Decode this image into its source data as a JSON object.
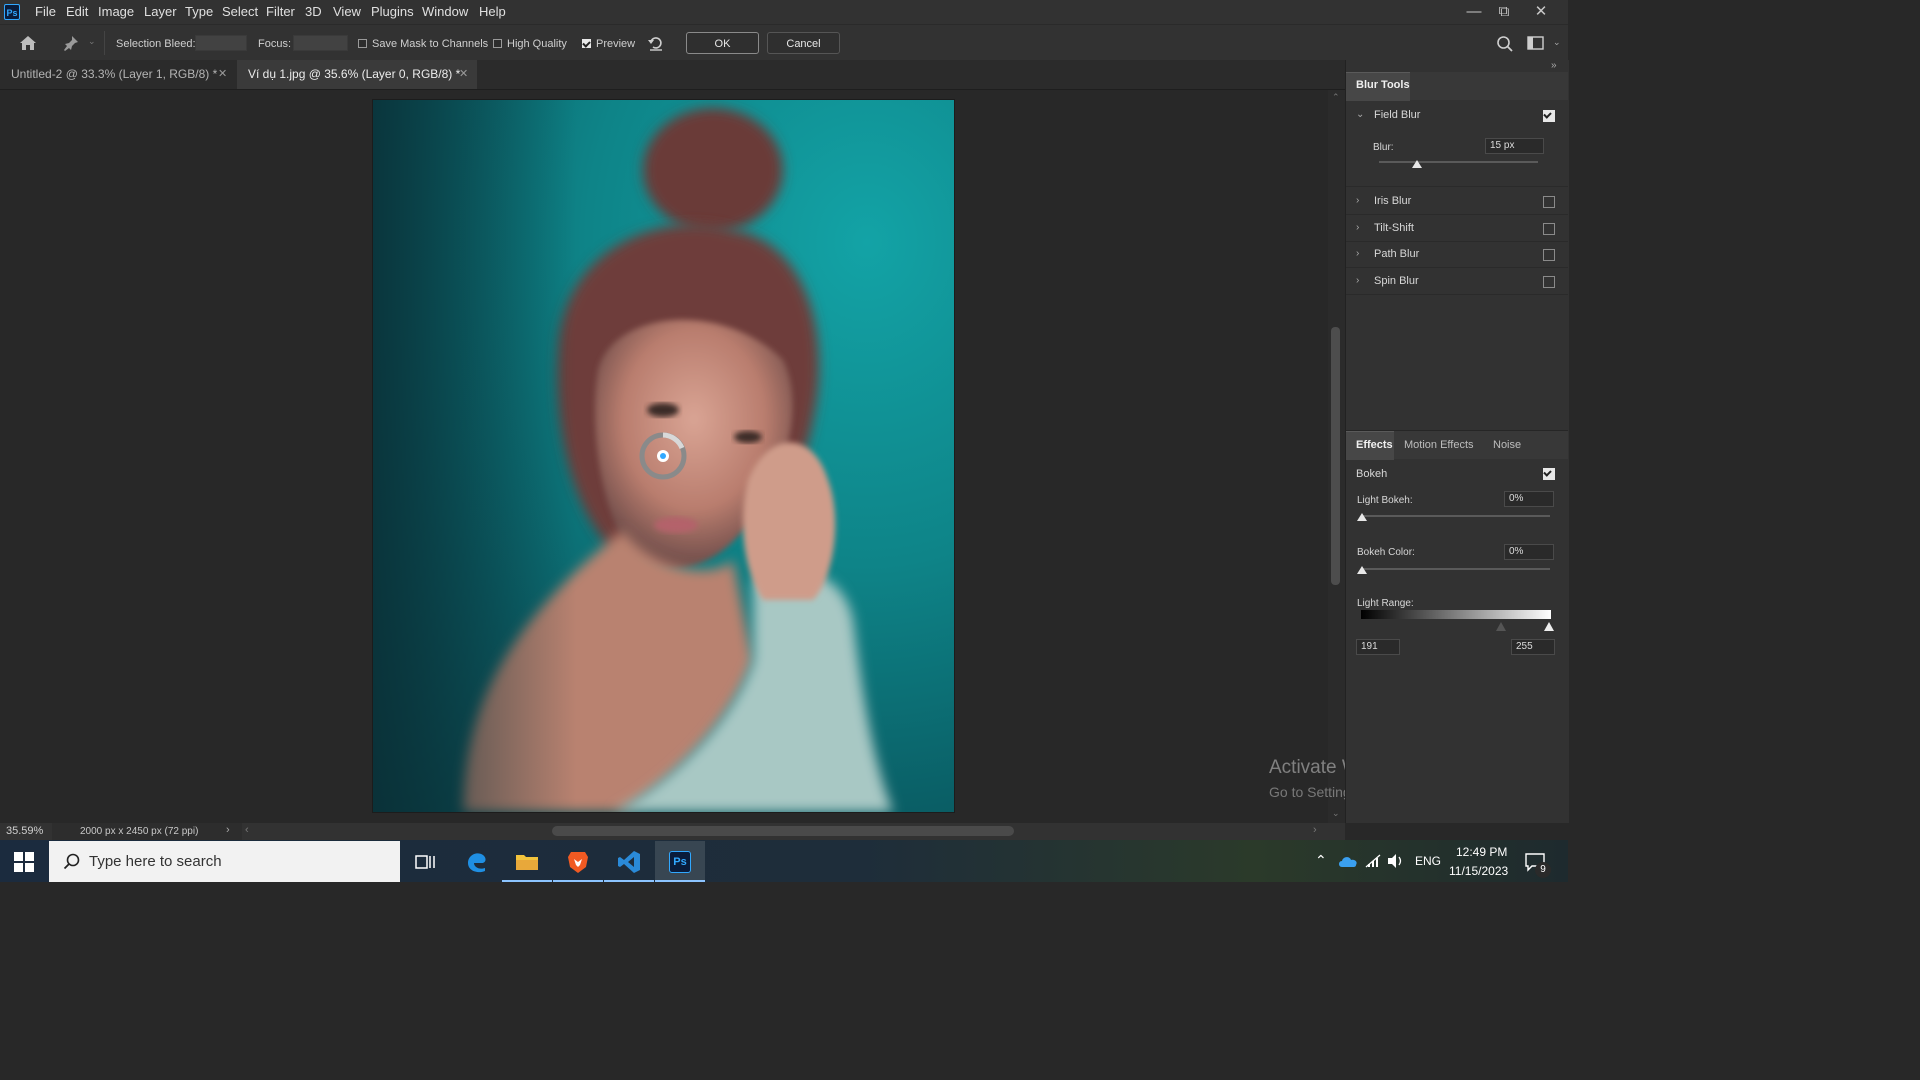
{
  "app": {
    "logo_text": "Ps"
  },
  "menu": [
    "File",
    "Edit",
    "Image",
    "Layer",
    "Type",
    "Select",
    "Filter",
    "3D",
    "View",
    "Plugins",
    "Window",
    "Help"
  ],
  "options_bar": {
    "selection_bleed_label": "Selection Bleed:",
    "focus_label": "Focus:",
    "save_mask_label": "Save Mask to Channels",
    "save_mask_checked": false,
    "high_quality_label": "High Quality",
    "high_quality_checked": false,
    "preview_label": "Preview",
    "preview_checked": true,
    "ok_label": "OK",
    "cancel_label": "Cancel"
  },
  "tabs": [
    {
      "label": "Untitled-2 @ 33.3% (Layer 1, RGB/8) *",
      "active": false
    },
    {
      "label": "Ví dụ 1.jpg @ 35.6% (Layer 0, RGB/8) *",
      "active": true
    }
  ],
  "blur_tools": {
    "title": "Blur Tools",
    "field_blur": {
      "label": "Field Blur",
      "checked": true,
      "blur_label": "Blur:",
      "blur_value": "15 px",
      "blur_slider_fraction": 0.24
    },
    "items": [
      {
        "label": "Iris Blur",
        "checked": false
      },
      {
        "label": "Tilt-Shift",
        "checked": false
      },
      {
        "label": "Path Blur",
        "checked": false
      },
      {
        "label": "Spin Blur",
        "checked": false
      }
    ]
  },
  "effects": {
    "tabs": [
      "Effects",
      "Motion Effects",
      "Noise"
    ],
    "active_tab": "Effects",
    "bokeh_label": "Bokeh",
    "bokeh_checked": true,
    "light_bokeh_label": "Light Bokeh:",
    "light_bokeh_value": "0%",
    "bokeh_color_label": "Bokeh Color:",
    "bokeh_color_value": "0%",
    "light_range_label": "Light Range:",
    "light_range_low": "191",
    "light_range_high": "255"
  },
  "status": {
    "zoom": "35.59%",
    "doc_info": "2000 px x 2450 px (72 ppi)"
  },
  "watermark": {
    "line1": "Activate Windows",
    "line2": "Go to Settings to activate Windows."
  },
  "taskbar": {
    "search_placeholder": "Type here to search",
    "lang": "ENG",
    "time": "12:49 PM",
    "date": "11/15/2023",
    "notification_count": "9"
  },
  "colors": {
    "accent": "#31a8ff",
    "teal_background": "#0e8488"
  }
}
